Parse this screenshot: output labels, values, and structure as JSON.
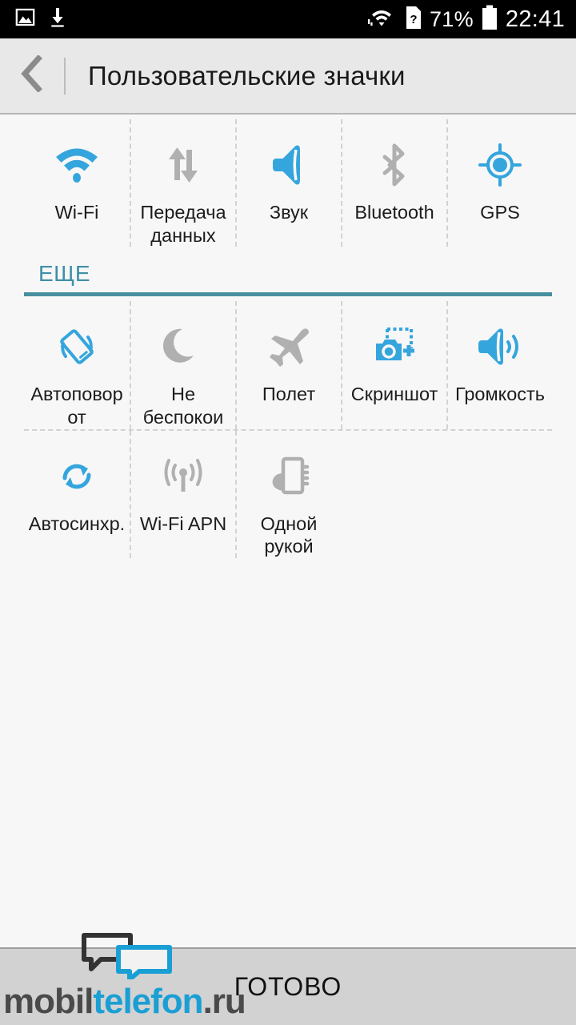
{
  "status_bar": {
    "left_icons": [
      "image-icon",
      "download-icon"
    ],
    "wifi_icon": "wifi-data-icon",
    "sim_icon": "sim-question-icon",
    "battery_percent": "71%",
    "battery_icon": "battery-icon",
    "clock": "22:41"
  },
  "header": {
    "back_icon": "back-chevron-icon",
    "title": "Пользовательские значки"
  },
  "sections": [
    {
      "id": "top",
      "heading": null,
      "rows": [
        [
          {
            "label": "Wi-Fi",
            "icon": "wifi-icon",
            "active": true
          },
          {
            "label": "Передача данных",
            "icon": "data-transfer-icon",
            "active": false
          },
          {
            "label": "Звук",
            "icon": "sound-icon",
            "active": true
          },
          {
            "label": "Bluetooth",
            "icon": "bluetooth-icon",
            "active": false
          },
          {
            "label": "GPS",
            "icon": "gps-icon",
            "active": true
          }
        ]
      ]
    },
    {
      "id": "more",
      "heading": "ЕЩЕ",
      "rows": [
        [
          {
            "label": "Автоповорот",
            "icon": "auto-rotate-icon",
            "active": true
          },
          {
            "label": "Не беспокои",
            "icon": "do-not-disturb-icon",
            "active": false
          },
          {
            "label": "Полет",
            "icon": "airplane-icon",
            "active": false
          },
          {
            "label": "Скриншот",
            "icon": "screenshot-icon",
            "active": true
          },
          {
            "label": "Громкость",
            "icon": "volume-icon",
            "active": true
          }
        ],
        [
          {
            "label": "Автосинхр.",
            "icon": "auto-sync-icon",
            "active": true
          },
          {
            "label": "Wi-Fi APN",
            "icon": "wifi-apn-icon",
            "active": false
          },
          {
            "label": "Одной рукой",
            "icon": "one-hand-icon",
            "active": false
          }
        ]
      ]
    }
  ],
  "bottom_bar": {
    "done_label": "ГОТОВО"
  },
  "watermark": {
    "part1": "mobil",
    "part2": "telefon",
    "part3": ".ru"
  },
  "colors": {
    "accent_blue": "#35a5dd",
    "inactive_gray": "#b0b0b0",
    "section_teal": "#3e8fa6",
    "status_bar_bg": "#000000",
    "header_bg": "#e8e8e8",
    "content_bg": "#f7f7f7",
    "bottom_bar_bg": "#d2d2d2"
  }
}
